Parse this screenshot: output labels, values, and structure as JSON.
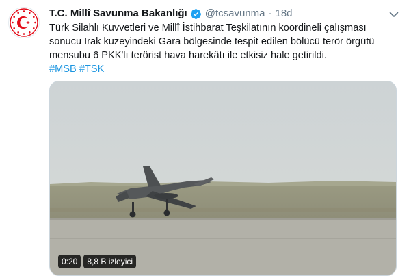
{
  "tweet": {
    "author_name": "T.C. Millî Savunma Bakanlığı",
    "handle": "@tcsavunma",
    "separator": "·",
    "time": "18d",
    "text_lines": [
      "Türk Silahlı Kuvvetleri ve Millî İstihbarat Teşkilatının koordineli çalışması",
      "sonucu Irak kuzeyindeki Gara bölgesinde tespit edilen bölücü terör örgütü",
      "mensubu 6 PKK'lı terörist hava harekâtı ile etkisiz hale getirildi."
    ],
    "hashtags": [
      "#MSB",
      "#TSK"
    ],
    "icons": {
      "avatar": "ministry-emblem-icon",
      "verified": "verified-badge-icon",
      "caret": "chevron-down-icon"
    },
    "colors": {
      "link": "#1b95e0",
      "verified": "#1da1f2",
      "secondary_text": "#657786",
      "emblem_red": "#e30a17"
    }
  },
  "video": {
    "duration": "0:20",
    "views": "8,8 B izleyici"
  }
}
